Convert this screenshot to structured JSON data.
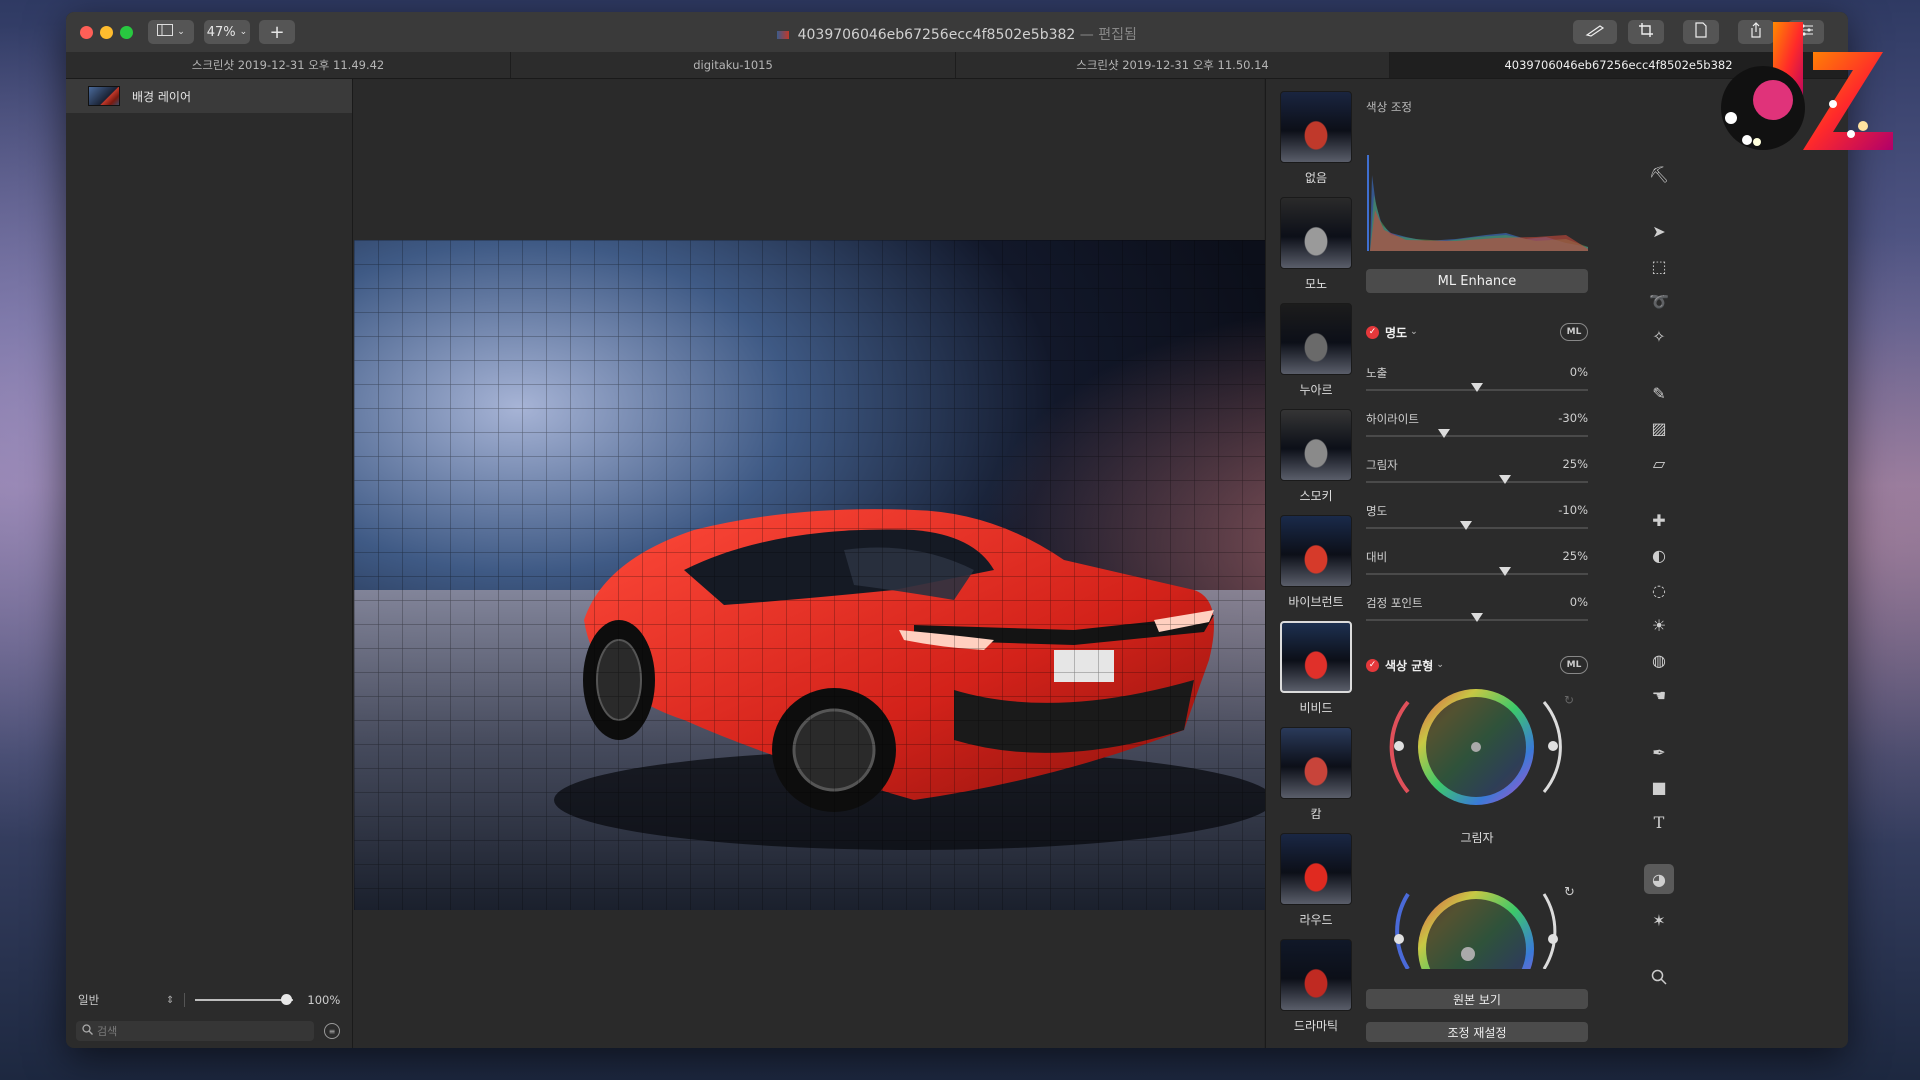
{
  "window": {
    "title": "4039706046eb67256ecc4f8502e5b382",
    "title_suffix": "— 편집됨",
    "zoom": "47%"
  },
  "tabs": [
    {
      "label": "스크린샷 2019-12-31 오후 11.49.42",
      "active": false
    },
    {
      "label": "digitaku-1015",
      "active": false
    },
    {
      "label": "스크린샷 2019-12-31 오후 11.50.14",
      "active": false
    },
    {
      "label": "4039706046eb67256ecc4f8502e5b382",
      "active": true
    }
  ],
  "layers": {
    "items": [
      {
        "name": "배경 레이어"
      }
    ],
    "blend_mode": "일반",
    "opacity": "100%",
    "search_placeholder": "검색"
  },
  "presets": [
    {
      "label": "없음",
      "selected": false
    },
    {
      "label": "모노",
      "selected": false
    },
    {
      "label": "누아르",
      "selected": false
    },
    {
      "label": "스모키",
      "selected": false
    },
    {
      "label": "바이브런트",
      "selected": false
    },
    {
      "label": "비비드",
      "selected": true
    },
    {
      "label": "캄",
      "selected": false
    },
    {
      "label": "라우드",
      "selected": false
    },
    {
      "label": "드라마틱",
      "selected": false
    }
  ],
  "adjust": {
    "section_title": "색상 조정",
    "ml_enhance": "ML Enhance",
    "light": {
      "title": "명도",
      "ml": "ML",
      "sliders": [
        {
          "name": "노출",
          "value": "0%",
          "pos": 0.5
        },
        {
          "name": "하이라이트",
          "value": "-30%",
          "pos": 0.35
        },
        {
          "name": "그림자",
          "value": "25%",
          "pos": 0.625
        },
        {
          "name": "명도",
          "value": "-10%",
          "pos": 0.45
        },
        {
          "name": "대비",
          "value": "25%",
          "pos": 0.625
        },
        {
          "name": "검정 포인트",
          "value": "0%",
          "pos": 0.5
        }
      ]
    },
    "color_balance": {
      "title": "색상 균형",
      "ml": "ML",
      "wheel_label": "그림자"
    },
    "show_original": "원본 보기",
    "reset": "조정 재설정"
  },
  "colors": {
    "accent_red": "#e5383b",
    "panel": "#2b2b2b"
  }
}
